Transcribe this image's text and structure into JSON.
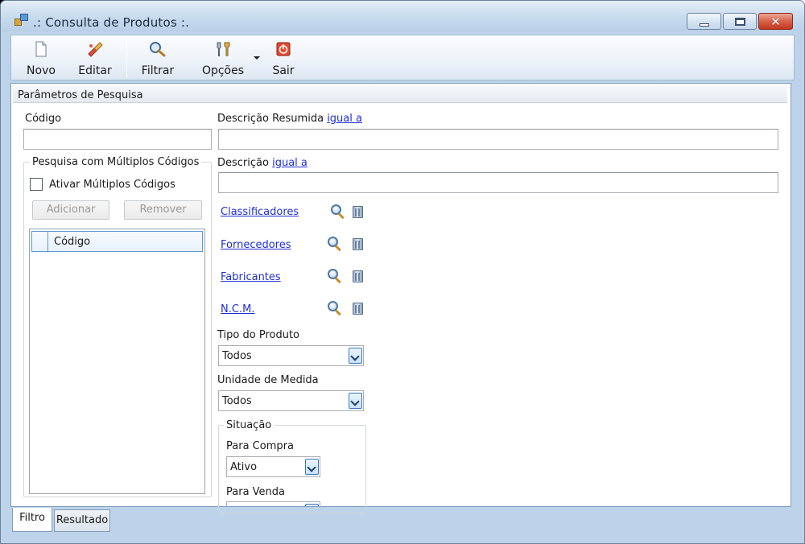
{
  "window": {
    "title": ".: Consulta de Produtos :."
  },
  "toolbar": {
    "items": [
      {
        "label": "Novo",
        "icon": "document-icon"
      },
      {
        "label": "Editar",
        "icon": "edit-brush-icon"
      },
      {
        "label": "Filtrar",
        "icon": "magnifier-icon"
      },
      {
        "label": "Opções",
        "icon": "tools-icon"
      },
      {
        "label": "Sair",
        "icon": "exit-icon"
      }
    ]
  },
  "params": {
    "header": "Parâmetros de Pesquisa",
    "codigo_label": "Código",
    "codigo_value": "",
    "multi_group_label": "Pesquisa com Múltiplos Códigos",
    "multi_checkbox_label": "Ativar Múltiplos Códigos",
    "add_button": "Adicionar",
    "remove_button": "Remover",
    "grid_column": "Código",
    "desc_resumida_label": "Descrição Resumida",
    "desc_resumida_link": "igual a",
    "desc_resumida_value": "",
    "descricao_label": "Descrição",
    "descricao_link": "igual a",
    "descricao_value": "",
    "lookups": [
      {
        "label": "Classificadores"
      },
      {
        "label": "Fornecedores"
      },
      {
        "label": "Fabricantes"
      },
      {
        "label": "N.C.M."
      }
    ],
    "tipo_label": "Tipo do Produto",
    "tipo_value": "Todos",
    "unidade_label": "Unidade de Medida",
    "unidade_value": "Todos",
    "situacao_label": "Situação",
    "compra_label": "Para Compra",
    "compra_value": "Ativo",
    "venda_label": "Para Venda",
    "venda_value": ""
  },
  "tabs": [
    {
      "label": "Filtro",
      "active": true
    },
    {
      "label": "Resultado",
      "active": false
    }
  ],
  "colors": {
    "link": "#1f2fd6",
    "frame": "#bcd3ea",
    "close_button": "#c1371f"
  }
}
